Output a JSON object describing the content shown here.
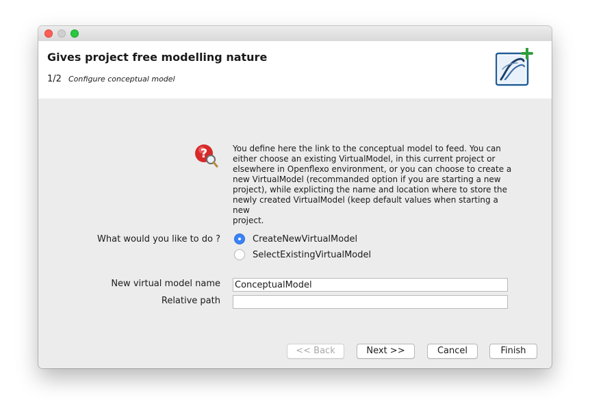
{
  "window": {
    "title": ""
  },
  "header": {
    "title": "Gives project free modelling nature",
    "step_count": "1/2",
    "step_description": "Configure conceptual model",
    "logo_icon": "openflexo-plus-icon"
  },
  "help": {
    "icon": "help-magnifier-icon",
    "lines": [
      "You define here the link to the conceptual model to feed. You can",
      "either choose an existing VirtualModel, in this current project or",
      "elsewhere in Openflexo environment, or you can choose to create a",
      "new VirtualModel (recommanded option if you are starting a new",
      "project), while explicting the name and location where to store the",
      "newly created VirtualModel (keep default values when starting a new",
      "project."
    ]
  },
  "form": {
    "choice_label": "What would you like to do ?",
    "options": [
      {
        "label": "CreateNewVirtualModel",
        "selected": true
      },
      {
        "label": "SelectExistingVirtualModel",
        "selected": false
      }
    ],
    "name_label": "New virtual model name",
    "name_value": "ConceptualModel",
    "path_label": "Relative path",
    "path_value": ""
  },
  "buttons": {
    "back": "<< Back",
    "next": "Next >>",
    "cancel": "Cancel",
    "finish": "Finish"
  },
  "colors": {
    "accent": "#3b82f7",
    "header_bg": "#ffffff",
    "content_bg": "#ececec",
    "close_light": "#fe5f57",
    "maximize_light": "#28c840"
  }
}
